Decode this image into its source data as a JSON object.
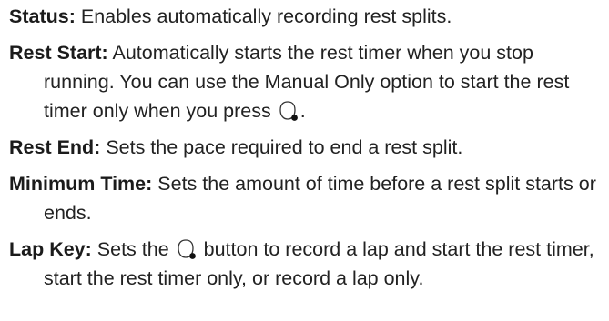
{
  "entries": [
    {
      "term": "Status:",
      "text": " Enables automatically recording rest splits."
    },
    {
      "term": "Rest Start:",
      "text_before_icon": " Automatically starts the rest timer when you stop running. You can use the Manual Only option to start the rest timer only when you press ",
      "icon": "watch-button-icon",
      "text_after_icon": "."
    },
    {
      "term": "Rest End:",
      "text": " Sets the pace required to end a rest split."
    },
    {
      "term": "Minimum Time:",
      "text": " Sets the amount of time before a rest split starts or ends."
    },
    {
      "term": "Lap Key:",
      "text_before_icon": " Sets the ",
      "icon": "watch-button-icon",
      "text_after_icon": " button to record a lap and start the rest timer, start the rest timer only, or record a lap only."
    }
  ]
}
